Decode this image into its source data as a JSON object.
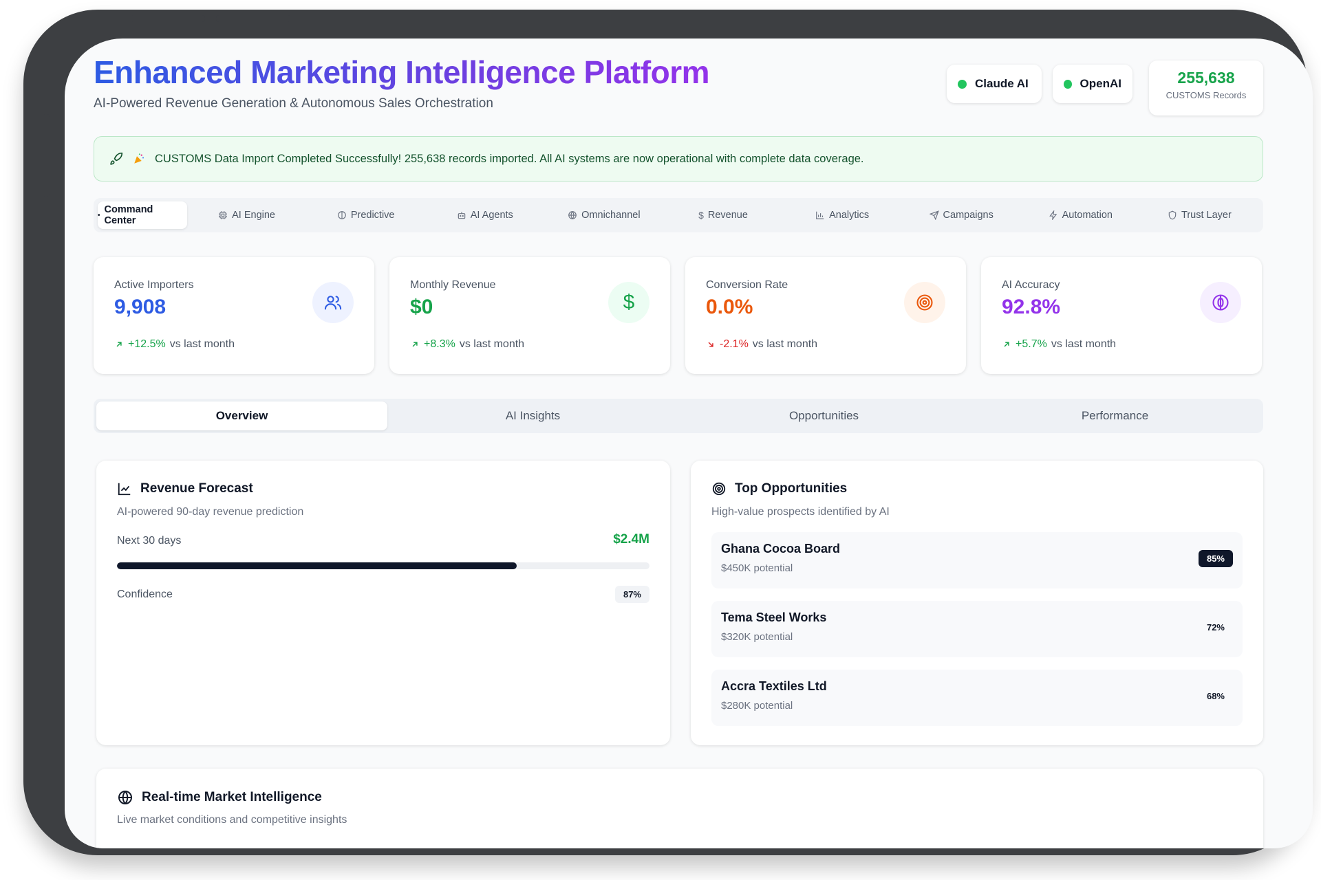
{
  "header": {
    "title": "Enhanced Marketing Intelligence Platform",
    "subtitle": "AI-Powered Revenue Generation & Autonomous Sales Orchestration",
    "status": [
      {
        "label": "Claude AI",
        "color": "#22c55e"
      },
      {
        "label": "OpenAI",
        "color": "#22c55e"
      }
    ],
    "records": {
      "value": "255,638",
      "label": "CUSTOMS Records"
    }
  },
  "banner": {
    "text": "CUSTOMS Data Import Completed Successfully! 255,638 records imported. All AI systems are now operational with complete data coverage."
  },
  "nav": {
    "items": [
      {
        "label": "Command Center",
        "icon": "dot-icon",
        "active": true
      },
      {
        "label": "AI Engine",
        "icon": "cpu-icon"
      },
      {
        "label": "Predictive",
        "icon": "brain-icon"
      },
      {
        "label": "AI Agents",
        "icon": "bot-icon"
      },
      {
        "label": "Omnichannel",
        "icon": "globe-icon"
      },
      {
        "label": "Revenue",
        "icon": "dollar-icon"
      },
      {
        "label": "Analytics",
        "icon": "bar-chart-icon"
      },
      {
        "label": "Campaigns",
        "icon": "send-icon"
      },
      {
        "label": "Automation",
        "icon": "zap-icon"
      },
      {
        "label": "Trust Layer",
        "icon": "shield-icon"
      }
    ]
  },
  "kpis": [
    {
      "label": "Active Importers",
      "value": "9,908",
      "trend": "+12.5%",
      "trend_suffix": "vs last month",
      "direction": "up",
      "color": "#2d5be3",
      "icon": "users-icon"
    },
    {
      "label": "Monthly Revenue",
      "value": "$0",
      "trend": "+8.3%",
      "trend_suffix": "vs last month",
      "direction": "up",
      "color": "#16a34a",
      "icon": "dollar-icon"
    },
    {
      "label": "Conversion Rate",
      "value": "0.0%",
      "trend": "-2.1%",
      "trend_suffix": "vs last month",
      "direction": "down",
      "color": "#ea580c",
      "icon": "target-icon"
    },
    {
      "label": "AI Accuracy",
      "value": "92.8%",
      "trend": "+5.7%",
      "trend_suffix": "vs last month",
      "direction": "up",
      "color": "#9333ea",
      "icon": "brain-icon"
    }
  ],
  "section_tabs": [
    {
      "label": "Overview",
      "active": true
    },
    {
      "label": "AI Insights"
    },
    {
      "label": "Opportunities"
    },
    {
      "label": "Performance"
    }
  ],
  "revenue_forecast": {
    "title": "Revenue Forecast",
    "subtitle": "AI-powered 90-day revenue prediction",
    "next_label": "Next 30 days",
    "amount": "$2.4M",
    "progress": 0.75,
    "confidence_label": "Confidence",
    "confidence": "87%"
  },
  "top_opportunities": {
    "title": "Top Opportunities",
    "subtitle": "High-value prospects identified by AI",
    "items": [
      {
        "name": "Ghana Cocoa Board",
        "potential": "$450K potential",
        "score": "85%",
        "highlight": true
      },
      {
        "name": "Tema Steel Works",
        "potential": "$320K potential",
        "score": "72%"
      },
      {
        "name": "Accra Textiles Ltd",
        "potential": "$280K potential",
        "score": "68%"
      }
    ]
  },
  "market_intel": {
    "title": "Real-time Market Intelligence",
    "subtitle": "Live market conditions and competitive insights"
  }
}
